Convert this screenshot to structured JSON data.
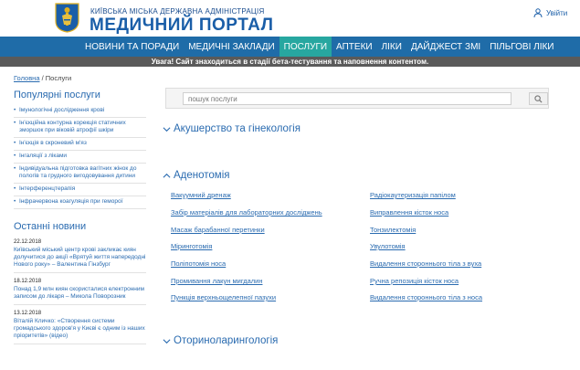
{
  "header": {
    "admin": "КИЇВСЬКА МІСЬКА ДЕРЖАВНА АДМІНІСТРАЦІЯ",
    "portal": "МЕДИЧНИЙ ПОРТАЛ",
    "login": "Увійти"
  },
  "nav": [
    "НОВИНИ ТА ПОРАДИ",
    "МЕДИЧНІ ЗАКЛАДИ",
    "ПОСЛУГИ",
    "АПТЕКИ",
    "ЛІКИ",
    "ДАЙДЖЕСТ ЗМІ",
    "ПІЛЬГОВІ ЛІКИ"
  ],
  "warning": "Увага! Сайт знаходиться в стадії бета-тестування та наповнення контентом.",
  "breadcrumb": {
    "home": "Головна",
    "sep": "/",
    "current": "Послуги"
  },
  "popular": {
    "title": "Популярні послуги",
    "items": [
      "Імунологічні дослідження крові",
      "Ін'єкційна контурна корекція статичних зморшок при віковій атрофії шкіри",
      "Ін'єкція в скроневий м'яз",
      "Інгаляції з ліками",
      "Індивідуальна підготовка вагітних жінок до пологів та грудного вигодовування дитини",
      "Інтерференцтерапія",
      "Інфрачервона коагуляція при геморої"
    ]
  },
  "latest": {
    "title": "Останні новини",
    "items": [
      {
        "date": "22.12.2018",
        "text": "Київський міський центр крові закликає киян долучитися до акції «Врятуй життя напередодні Нового року» – Валентина Гінзбург"
      },
      {
        "date": "18.12.2018",
        "text": "Понад 1,9 млн киян скористалися електронним записом до лікаря – Микола Поворозник"
      },
      {
        "date": "13.12.2018",
        "text": "Віталій Кличко: «Створення системи громадського здоров'я у Києві є одним із наших пріоритетів» (відео)"
      }
    ]
  },
  "search": {
    "placeholder": "пошук послуги"
  },
  "categories": [
    "Акушерство та гінекологія",
    "Аденотомія",
    "Оториноларингологія"
  ],
  "services_left": [
    "Вакуумний дренаж",
    "Забір матеріалів для лабораторних досліджень",
    "Масаж барабанної перетинки",
    "Міринготомія",
    "Поліпотомія носа",
    "Промивання лакун мигдалин",
    "Пункція верхньощелепної пазухи"
  ],
  "services_right": [
    "Радіокаутеризація папілом",
    "Виправлення кісток носа",
    "Тонзилектомія",
    "Увулотомія",
    "Видалення стороннього тіла з вуха",
    "Ручна репозиція кісток носа",
    "Видалення стороннього тіла з носа"
  ]
}
